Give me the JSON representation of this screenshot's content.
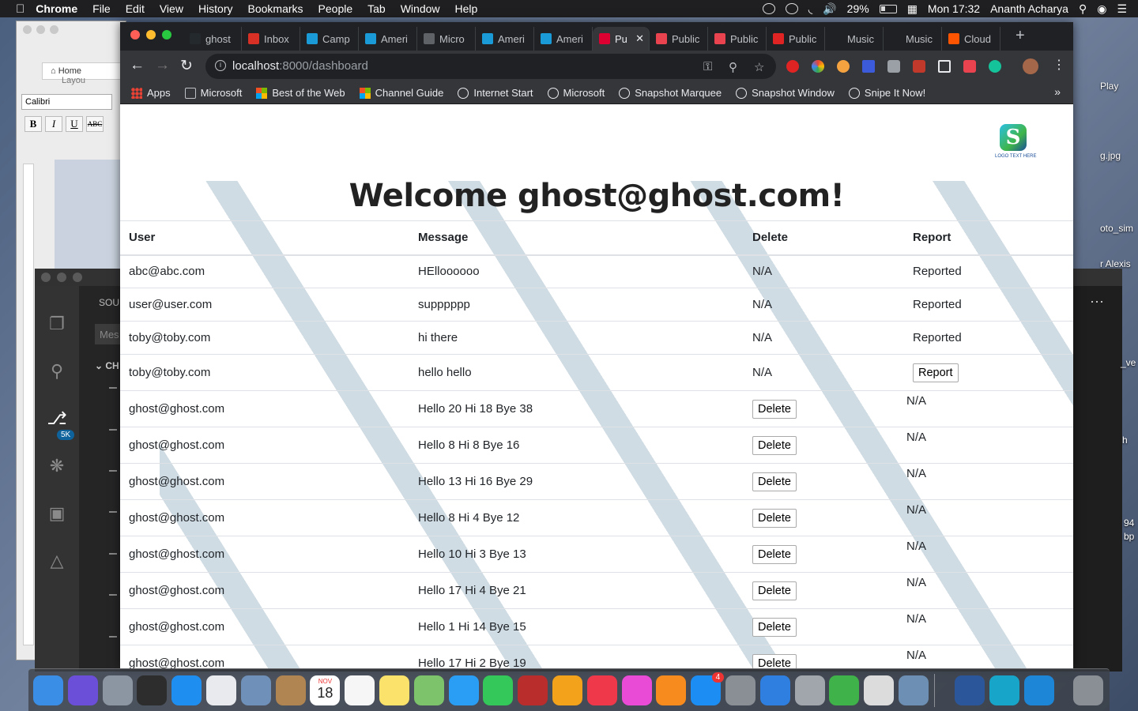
{
  "menubar": {
    "app": "Chrome",
    "items": [
      "File",
      "Edit",
      "View",
      "History",
      "Bookmarks",
      "People",
      "Tab",
      "Window",
      "Help"
    ],
    "battery": "29%",
    "clock": "Mon 17:32",
    "user": "Ananth Acharya"
  },
  "word": {
    "home_tab": "Home",
    "layout_tab": "Layou",
    "font": "Calibri"
  },
  "vscode": {
    "sidebar_title": "SOU",
    "message_placeholder": "Mes",
    "changes": "CH",
    "scm_badge": "5K"
  },
  "desktop_labels": [
    "Play",
    "g.jpg",
    "oto_sim",
    "r Alexis",
    "h",
    "94",
    "bp",
    "_ve"
  ],
  "chrome": {
    "tabs": [
      {
        "label": "ghost",
        "color": "#24292e"
      },
      {
        "label": "Inbox",
        "color": "#d93025"
      },
      {
        "label": "Camp",
        "color": "#1a9bd7"
      },
      {
        "label": "Ameri",
        "color": "#1a9bd7"
      },
      {
        "label": "Micro",
        "color": "#5f6368"
      },
      {
        "label": "Ameri",
        "color": "#1a9bd7"
      },
      {
        "label": "Ameri",
        "color": "#1a9bd7"
      },
      {
        "label": "Pu",
        "color": "#dd0031",
        "active": true
      },
      {
        "label": "Public",
        "color": "#e8434f"
      },
      {
        "label": "Public",
        "color": "#e8434f"
      },
      {
        "label": "Public",
        "color": "#e02424"
      },
      {
        "label": "Music",
        "color": "#202124"
      },
      {
        "label": "Music",
        "color": "#202124"
      },
      {
        "label": "Cloud",
        "color": "#ff5500"
      }
    ],
    "url_host": "localhost",
    "url_path": ":8000/dashboard",
    "bookmarks": [
      {
        "label": "Apps",
        "icon": "apps"
      },
      {
        "label": "Microsoft",
        "icon": "folder"
      },
      {
        "label": "Best of the Web",
        "icon": "ms"
      },
      {
        "label": "Channel Guide",
        "icon": "ms"
      },
      {
        "label": "Internet Start",
        "icon": "globe"
      },
      {
        "label": "Microsoft",
        "icon": "globe"
      },
      {
        "label": "Snapshot Marquee",
        "icon": "globe"
      },
      {
        "label": "Snapshot Window",
        "icon": "globe"
      },
      {
        "label": "Snipe It Now!",
        "icon": "globe"
      }
    ]
  },
  "page": {
    "logo_text": "LOGO TEXT HERE",
    "welcome": "Welcome ghost@ghost.com!",
    "headers": {
      "user": "User",
      "message": "Message",
      "delete": "Delete",
      "report": "Report"
    },
    "rows": [
      {
        "user": "abc@abc.com",
        "message": "HElloooooo",
        "delete": "N/A",
        "report": "Reported"
      },
      {
        "user": "user@user.com",
        "message": "supppppp",
        "delete": "N/A",
        "report": "Reported"
      },
      {
        "user": "toby@toby.com",
        "message": "hi there",
        "delete": "N/A",
        "report": "Reported"
      },
      {
        "user": "toby@toby.com",
        "message": "hello hello",
        "delete": "N/A",
        "report_button": "Report"
      },
      {
        "user": "ghost@ghost.com",
        "message": "Hello 20 Hi 18 Bye 38",
        "delete_button": "Delete",
        "report": "N/A"
      },
      {
        "user": "ghost@ghost.com",
        "message": "Hello 8 Hi 8 Bye 16",
        "delete_button": "Delete",
        "report": "N/A"
      },
      {
        "user": "ghost@ghost.com",
        "message": "Hello 13 Hi 16 Bye 29",
        "delete_button": "Delete",
        "report": "N/A"
      },
      {
        "user": "ghost@ghost.com",
        "message": "Hello 8 Hi 4 Bye 12",
        "delete_button": "Delete",
        "report": "N/A"
      },
      {
        "user": "ghost@ghost.com",
        "message": "Hello 10 Hi 3 Bye 13",
        "delete_button": "Delete",
        "report": "N/A"
      },
      {
        "user": "ghost@ghost.com",
        "message": "Hello 17 Hi 4 Bye 21",
        "delete_button": "Delete",
        "report": "N/A"
      },
      {
        "user": "ghost@ghost.com",
        "message": "Hello 1 Hi 14 Bye 15",
        "delete_button": "Delete",
        "report": "N/A"
      },
      {
        "user": "ghost@ghost.com",
        "message": "Hello 17 Hi 2 Bye 19",
        "delete_button": "Delete",
        "report": "N/A"
      }
    ]
  },
  "dock": {
    "apps": [
      {
        "name": "finder",
        "color": "#3a8ee6"
      },
      {
        "name": "siri",
        "color": "#6b4fd8"
      },
      {
        "name": "launchpad",
        "color": "#8c96a3"
      },
      {
        "name": "photo-booth",
        "color": "#2d2d2d"
      },
      {
        "name": "safari",
        "color": "#1f8ef1"
      },
      {
        "name": "chrome",
        "color": "#e8eaed"
      },
      {
        "name": "preview",
        "color": "#6f90b8"
      },
      {
        "name": "contacts",
        "color": "#b08552"
      },
      {
        "name": "calendar",
        "color": "#ffffff"
      },
      {
        "name": "reminders",
        "color": "#f6f6f6"
      },
      {
        "name": "notes",
        "color": "#fbe26a"
      },
      {
        "name": "maps",
        "color": "#7cc36b"
      },
      {
        "name": "messages",
        "color": "#2a9df4"
      },
      {
        "name": "facetime",
        "color": "#34c759"
      },
      {
        "name": "photo-app",
        "color": "#b92d2d"
      },
      {
        "name": "photos",
        "color": "#f3a21b"
      },
      {
        "name": "news",
        "color": "#f0384b"
      },
      {
        "name": "itunes",
        "color": "#e94ad6"
      },
      {
        "name": "books",
        "color": "#f78b1e"
      },
      {
        "name": "app-store",
        "color": "#1c8df2"
      },
      {
        "name": "system-preferences",
        "color": "#8a8f96"
      },
      {
        "name": "keynote",
        "color": "#2f7fe0"
      },
      {
        "name": "script-editor",
        "color": "#a1a6ad"
      },
      {
        "name": "numbers",
        "color": "#3fb24a"
      },
      {
        "name": "text-edit",
        "color": "#dcdcdc"
      },
      {
        "name": "image-capture",
        "color": "#6d8fb3"
      },
      {
        "name": "word",
        "color": "#2b579a"
      },
      {
        "name": "screen-recorder",
        "color": "#17a6c9"
      },
      {
        "name": "vscode",
        "color": "#1e86d6"
      },
      {
        "name": "trash",
        "color": "#8a8f96"
      }
    ],
    "calendar_month": "NOV",
    "calendar_day": "18",
    "app_store_badge": "4"
  }
}
